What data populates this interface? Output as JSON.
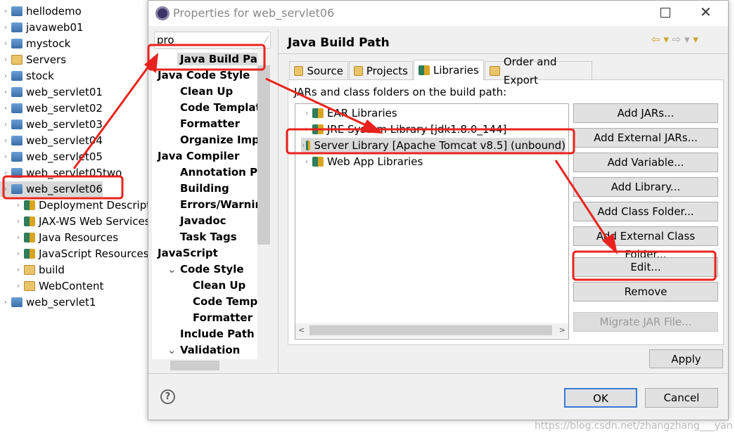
{
  "explorer": {
    "items": [
      {
        "label": "hellodemo",
        "type": "project"
      },
      {
        "label": "javaweb01",
        "type": "project"
      },
      {
        "label": "mystock",
        "type": "project"
      },
      {
        "label": "Servers",
        "type": "folder"
      },
      {
        "label": "stock",
        "type": "project"
      },
      {
        "label": "web_servlet01",
        "type": "project"
      },
      {
        "label": "web_servlet02",
        "type": "project"
      },
      {
        "label": "web_servlet03",
        "type": "project"
      },
      {
        "label": "web_servlet04",
        "type": "project"
      },
      {
        "label": "web_servlet05",
        "type": "project"
      },
      {
        "label": "web_servlet05two",
        "type": "project"
      },
      {
        "label": "web_servlet06",
        "type": "project",
        "selected": true
      },
      {
        "label": "Deployment Descriptor",
        "type": "child"
      },
      {
        "label": "JAX-WS Web Services",
        "type": "child"
      },
      {
        "label": "Java Resources",
        "type": "child"
      },
      {
        "label": "JavaScript Resources",
        "type": "child"
      },
      {
        "label": "build",
        "type": "folder-child"
      },
      {
        "label": "WebContent",
        "type": "folder-child"
      },
      {
        "label": "web_servlet1",
        "type": "project"
      }
    ]
  },
  "dialog": {
    "title": "Properties for web_servlet06",
    "filter": "pro",
    "tree": [
      {
        "label": "Java Build Path",
        "level": 1,
        "selected": true
      },
      {
        "label": "Java Code Style",
        "level": 0
      },
      {
        "label": "Clean Up",
        "level": 1
      },
      {
        "label": "Code Templates",
        "level": 1
      },
      {
        "label": "Formatter",
        "level": 1
      },
      {
        "label": "Organize Imports",
        "level": 1
      },
      {
        "label": "Java Compiler",
        "level": 0
      },
      {
        "label": "Annotation Processing",
        "level": 1
      },
      {
        "label": "Building",
        "level": 1
      },
      {
        "label": "Errors/Warnings",
        "level": 1
      },
      {
        "label": "Javadoc",
        "level": 1
      },
      {
        "label": "Task Tags",
        "level": 1
      },
      {
        "label": "JavaScript",
        "level": 0
      },
      {
        "label": "Code Style",
        "level": 1
      },
      {
        "label": "Clean Up",
        "level": 2
      },
      {
        "label": "Code Templates",
        "level": 2
      },
      {
        "label": "Formatter",
        "level": 2
      },
      {
        "label": "Include Path",
        "level": 1
      },
      {
        "label": "Validation",
        "level": 1
      }
    ],
    "page_title": "Java Build Path",
    "tabs": [
      "Source",
      "Projects",
      "Libraries",
      "Order and Export"
    ],
    "active_tab": "Libraries",
    "list_label": "JARs and class folders on the build path:",
    "libraries": [
      "EAR Libraries",
      "JRE System Library [jdk1.8.0_144]",
      "Server Library [Apache Tomcat v8.5] (unbound)",
      "Web App Libraries"
    ],
    "buttons": [
      "Add JARs...",
      "Add External JARs...",
      "Add Variable...",
      "Add Library...",
      "Add Class Folder...",
      "Add External Class Folder...",
      "Edit...",
      "Remove",
      "Migrate JAR File..."
    ],
    "apply": "Apply",
    "ok": "OK",
    "cancel": "Cancel",
    "help": "?"
  },
  "watermark": "https://blog.csdn.net/zhangzhang___yan",
  "colors": {
    "annotation": "#e8231e",
    "selection": "#d9d9d9"
  }
}
